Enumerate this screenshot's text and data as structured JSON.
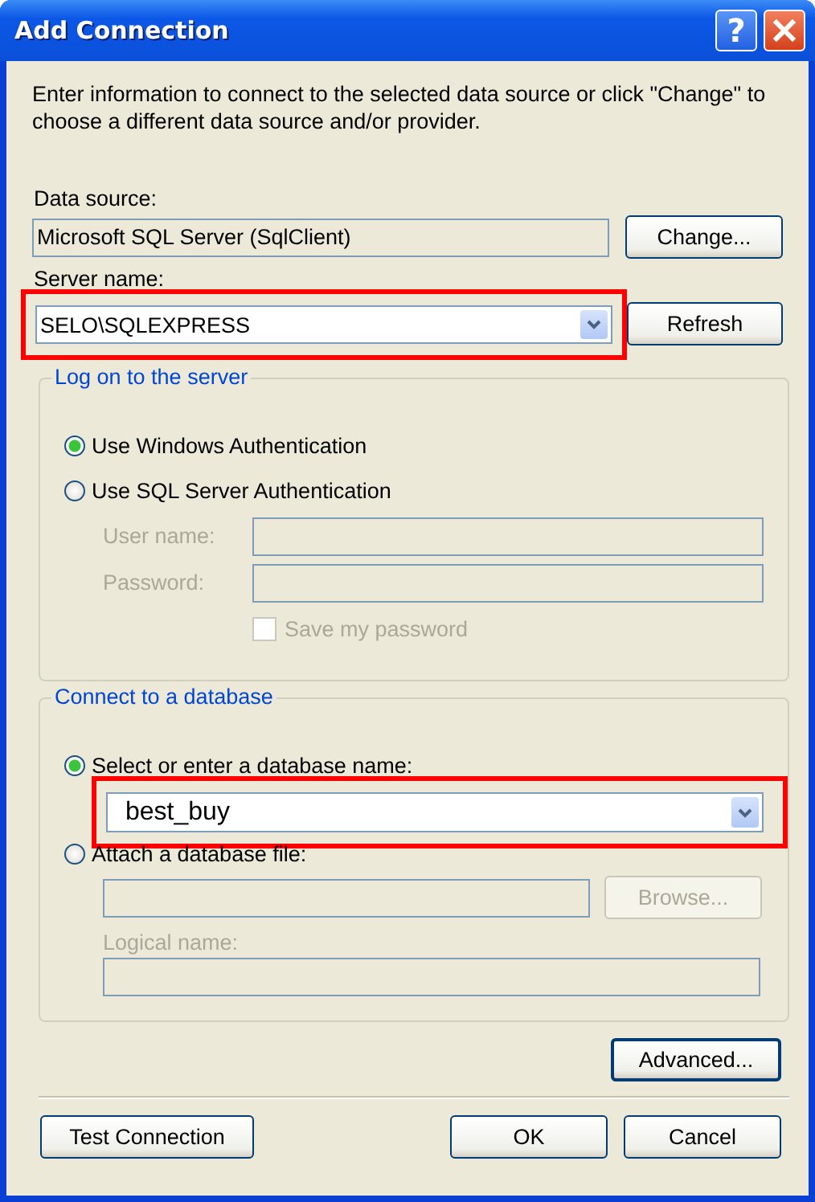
{
  "window": {
    "title": "Add Connection",
    "help_button": "?"
  },
  "intro": "Enter information to connect to the selected data source or click \"Change\" to choose a different data source and/or provider.",
  "data_source": {
    "label": "Data source:",
    "value": "Microsoft SQL Server (SqlClient)",
    "read_only": true,
    "button": "Change..."
  },
  "server_name": {
    "label": "Server name:",
    "value": "SELO\\SQLEXPRESS",
    "highlighted": true,
    "button": "Refresh"
  },
  "logon": {
    "title": "Log on to the server",
    "options": [
      {
        "label": "Use Windows Authentication",
        "selected": true
      },
      {
        "label": "Use SQL Server Authentication",
        "selected": false
      }
    ],
    "user_name": {
      "label": "User name:",
      "disabled": true
    },
    "password": {
      "label": "Password:",
      "disabled": true
    },
    "save_password": {
      "label": "Save my password",
      "checked": false,
      "disabled": true
    }
  },
  "database": {
    "title": "Connect to a database",
    "options": [
      {
        "label": "Select or enter a database name:",
        "selected": true
      },
      {
        "label": "Attach a database file:",
        "selected": false
      }
    ],
    "database_name": {
      "value": "best_buy",
      "highlighted": true
    },
    "file": {
      "disabled": true
    },
    "browse": {
      "label": "Browse...",
      "disabled": true
    },
    "logical_name": {
      "label": "Logical name:",
      "disabled": true
    }
  },
  "advanced_button": "Advanced...",
  "buttons": [
    {
      "label": "Test Connection"
    },
    {
      "label": "OK"
    },
    {
      "label": "Cancel"
    }
  ]
}
